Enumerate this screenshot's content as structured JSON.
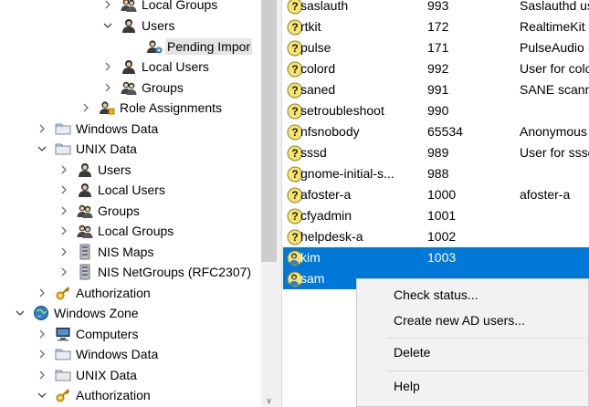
{
  "tree": {
    "nodes": [
      {
        "label": "Local Groups",
        "expander": "collapsed",
        "icon": "group-icon",
        "selected": false
      },
      {
        "label": "Users",
        "expander": "expanded",
        "icon": "user-icon",
        "selected": false
      },
      {
        "label": "Pending Impor",
        "expander": "none",
        "icon": "pending-users-icon",
        "selected": true
      },
      {
        "label": "Local Users",
        "expander": "collapsed",
        "icon": "user-icon",
        "selected": false
      },
      {
        "label": "Groups",
        "expander": "collapsed",
        "icon": "group-icon",
        "selected": false
      },
      {
        "label": "Role Assignments",
        "expander": "collapsed",
        "icon": "role-icon",
        "selected": false
      },
      {
        "label": "Windows Data",
        "expander": "collapsed",
        "icon": "folder-icon",
        "selected": false
      },
      {
        "label": "UNIX Data",
        "expander": "expanded",
        "icon": "folder-icon",
        "selected": false
      },
      {
        "label": "Users",
        "expander": "collapsed",
        "icon": "user-icon",
        "selected": false
      },
      {
        "label": "Local Users",
        "expander": "collapsed",
        "icon": "user-icon",
        "selected": false
      },
      {
        "label": "Groups",
        "expander": "collapsed",
        "icon": "group-icon",
        "selected": false
      },
      {
        "label": "Local Groups",
        "expander": "collapsed",
        "icon": "group-icon",
        "selected": false
      },
      {
        "label": "NIS Maps",
        "expander": "collapsed",
        "icon": "nis-map-icon",
        "selected": false
      },
      {
        "label": "NIS NetGroups (RFC2307)",
        "expander": "collapsed",
        "icon": "nis-map-icon",
        "selected": false
      },
      {
        "label": "Authorization",
        "expander": "collapsed",
        "icon": "key-icon",
        "selected": false
      },
      {
        "label": "Windows Zone",
        "expander": "expanded",
        "icon": "globe-icon",
        "selected": false
      },
      {
        "label": "Computers",
        "expander": "collapsed",
        "icon": "computer-icon",
        "selected": false
      },
      {
        "label": "Windows Data",
        "expander": "collapsed",
        "icon": "folder-icon",
        "selected": false
      },
      {
        "label": "UNIX Data",
        "expander": "collapsed",
        "icon": "folder-icon",
        "selected": false
      },
      {
        "label": "Authorization",
        "expander": "expanded",
        "icon": "key-icon",
        "selected": false
      }
    ]
  },
  "list": {
    "rows": [
      {
        "name": "saslauth",
        "uid": "993",
        "desc": "Saslauthd use",
        "selected": false
      },
      {
        "name": "rtkit",
        "uid": "172",
        "desc": "RealtimeKit",
        "selected": false
      },
      {
        "name": "pulse",
        "uid": "171",
        "desc": "PulseAudio S",
        "selected": false
      },
      {
        "name": "colord",
        "uid": "992",
        "desc": "User for colo",
        "selected": false
      },
      {
        "name": "saned",
        "uid": "991",
        "desc": "SANE scanne",
        "selected": false
      },
      {
        "name": "setroubleshoot",
        "uid": "990",
        "desc": "",
        "selected": false
      },
      {
        "name": "nfsnobody",
        "uid": "65534",
        "desc": "Anonymous",
        "selected": false
      },
      {
        "name": "sssd",
        "uid": "989",
        "desc": "User for sssd",
        "selected": false
      },
      {
        "name": "gnome-initial-s...",
        "uid": "988",
        "desc": "",
        "selected": false
      },
      {
        "name": "afoster-a",
        "uid": "1000",
        "desc": "afoster-a",
        "selected": false
      },
      {
        "name": "cfyadmin",
        "uid": "1001",
        "desc": "",
        "selected": false
      },
      {
        "name": "helpdesk-a",
        "uid": "1002",
        "desc": "",
        "selected": false
      },
      {
        "name": "kim",
        "uid": "1003",
        "desc": "",
        "selected": true
      },
      {
        "name": "sam",
        "uid": "",
        "desc": "",
        "selected": true
      }
    ]
  },
  "context_menu": {
    "items": [
      {
        "label": "Check status..."
      },
      {
        "label": "Create new AD users..."
      },
      {
        "label": "Delete"
      },
      {
        "label": "Help"
      }
    ]
  },
  "colors": {
    "selection": "#0078d7",
    "tree_selection": "#e5e5e5",
    "menu_bg": "#f2f2f2"
  }
}
